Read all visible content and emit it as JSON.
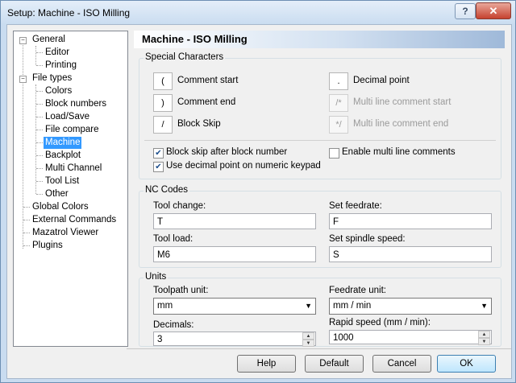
{
  "window": {
    "title": "Setup: Machine - ISO Milling",
    "help_label": "?",
    "close_label": "✕"
  },
  "tree": {
    "items": [
      {
        "label": "General"
      },
      {
        "label": "Editor"
      },
      {
        "label": "Printing"
      },
      {
        "label": "File types"
      },
      {
        "label": "Colors"
      },
      {
        "label": "Block numbers"
      },
      {
        "label": "Load/Save"
      },
      {
        "label": "File compare"
      },
      {
        "label": "Machine"
      },
      {
        "label": "Backplot"
      },
      {
        "label": "Multi Channel"
      },
      {
        "label": "Tool List"
      },
      {
        "label": "Other"
      },
      {
        "label": "Global Colors"
      },
      {
        "label": "External Commands"
      },
      {
        "label": "Mazatrol Viewer"
      },
      {
        "label": "Plugins"
      }
    ],
    "expand_symbol": "−"
  },
  "header": {
    "title": "Machine - ISO Milling"
  },
  "special": {
    "title": "Special Characters",
    "comment_start": {
      "char": "(",
      "label": "Comment start"
    },
    "comment_end": {
      "char": ")",
      "label": "Comment end"
    },
    "block_skip": {
      "char": "/",
      "label": "Block Skip"
    },
    "decimal_point": {
      "char": ".",
      "label": "Decimal point"
    },
    "multi_start": {
      "char": "/*",
      "label": "Multi line comment start"
    },
    "multi_end": {
      "char": "*/",
      "label": "Multi line comment end"
    },
    "cb_block_skip": {
      "label": "Block skip after block number",
      "checked": "✔"
    },
    "cb_decimal": {
      "label": "Use decimal point on numeric keypad",
      "checked": "✔"
    },
    "cb_multi": {
      "label": "Enable multi line comments",
      "checked": ""
    }
  },
  "nc": {
    "title": "NC Codes",
    "tool_change": {
      "label": "Tool change:",
      "value": "T"
    },
    "set_feedrate": {
      "label": "Set feedrate:",
      "value": "F"
    },
    "tool_load": {
      "label": "Tool load:",
      "value": "M6"
    },
    "set_spindle": {
      "label": "Set spindle speed:",
      "value": "S"
    }
  },
  "units": {
    "title": "Units",
    "toolpath": {
      "label": "Toolpath unit:",
      "value": "mm"
    },
    "feedrate": {
      "label": "Feedrate unit:",
      "value": "mm / min"
    },
    "decimals": {
      "label": "Decimals:",
      "value": "3"
    },
    "rapid": {
      "label": "Rapid speed (mm / min):",
      "value": "1000"
    },
    "arrow_down": "▼",
    "spin_up": "▲",
    "spin_down": "▼"
  },
  "buttons": {
    "help": "Help",
    "default": "Default",
    "cancel": "Cancel",
    "ok": "OK"
  }
}
